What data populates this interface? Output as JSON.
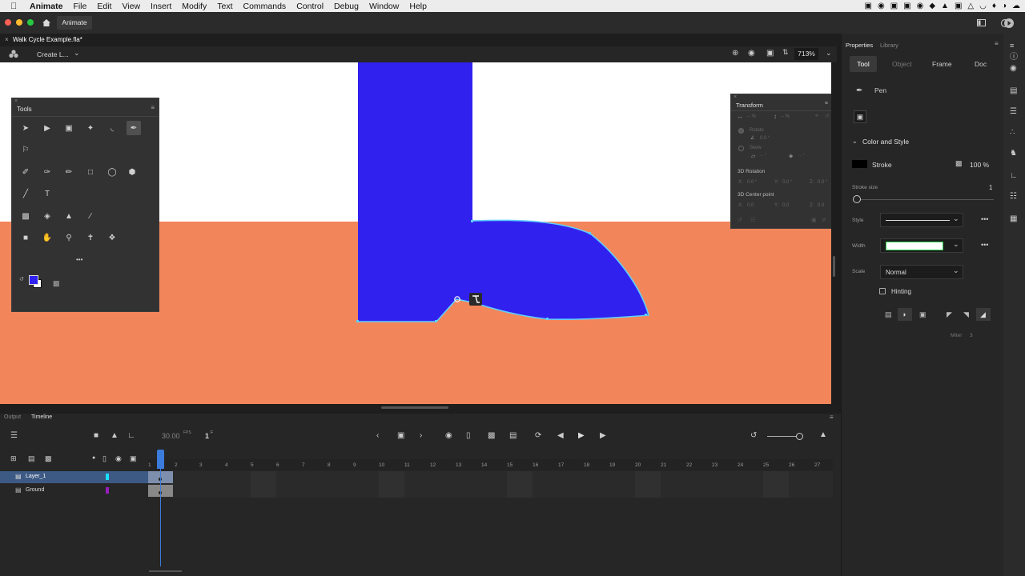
{
  "menubar": {
    "app": "Animate",
    "items": [
      "File",
      "Edit",
      "View",
      "Insert",
      "Modify",
      "Text",
      "Commands",
      "Control",
      "Debug",
      "Window",
      "Help"
    ]
  },
  "titlebar": {
    "workspace_tab": "Animate"
  },
  "document": {
    "tab_title": "Walk Cycle Example.fla*"
  },
  "stage_toolbar": {
    "scene_dropdown": "Create L...",
    "zoom": "713%"
  },
  "tools_panel": {
    "title": "Tools",
    "more": "•••"
  },
  "transform_panel": {
    "title": "Transform",
    "width_val": "-- %",
    "height_val": "-- %",
    "rotate_label": "Rotate",
    "rotate_val": "0.0 °",
    "skew_label": "Skew",
    "skew_h": "-- °",
    "skew_v": "-- °",
    "rotation3d_label": "3D Rotation",
    "rot3d": {
      "x_label": "X:",
      "x": "0.0 °",
      "y_label": "Y:",
      "y": "0.0 °",
      "z_label": "Z:",
      "z": "0.0 °"
    },
    "center3d_label": "3D Center point",
    "center3d": {
      "x_label": "X:",
      "x": "0.0",
      "y_label": "Y:",
      "y": "0.0",
      "z_label": "Z:",
      "z": "0.0"
    }
  },
  "properties": {
    "tabs_top": [
      "Properties",
      "Library"
    ],
    "tabs": [
      "Tool",
      "Object",
      "Frame",
      "Doc"
    ],
    "tool_name": "Pen",
    "section": "Color and Style",
    "stroke_label": "Stroke",
    "stroke_opacity": "100 %",
    "stroke_size_label": "Stroke size",
    "stroke_size": "1",
    "style_label": "Style",
    "width_label": "Width",
    "scale_label": "Scale",
    "scale_value": "Normal",
    "hinting_label": "Hinting",
    "miter_label": "Miter",
    "miter_value": "3"
  },
  "timeline": {
    "tabs": [
      "Output",
      "Timeline"
    ],
    "fps": "30.00",
    "fps_unit": "FPS",
    "current_frame": "1",
    "frame_unit": "F",
    "frame_numbers": [
      "1",
      "2",
      "3",
      "4",
      "5",
      "6",
      "7",
      "8",
      "9",
      "10",
      "11",
      "12",
      "13",
      "14",
      "15",
      "16",
      "17",
      "18",
      "19",
      "20",
      "21",
      "22",
      "23",
      "24",
      "25",
      "26",
      "27"
    ],
    "layers": [
      {
        "name": "Layer_1",
        "color": "#19e0ff",
        "selected": true
      },
      {
        "name": "Ground",
        "color": "#9a1dbd",
        "selected": false
      }
    ]
  },
  "colors": {
    "fill": "#3121ee",
    "ground": "#f2865a",
    "selection": "#5fd0ff"
  }
}
